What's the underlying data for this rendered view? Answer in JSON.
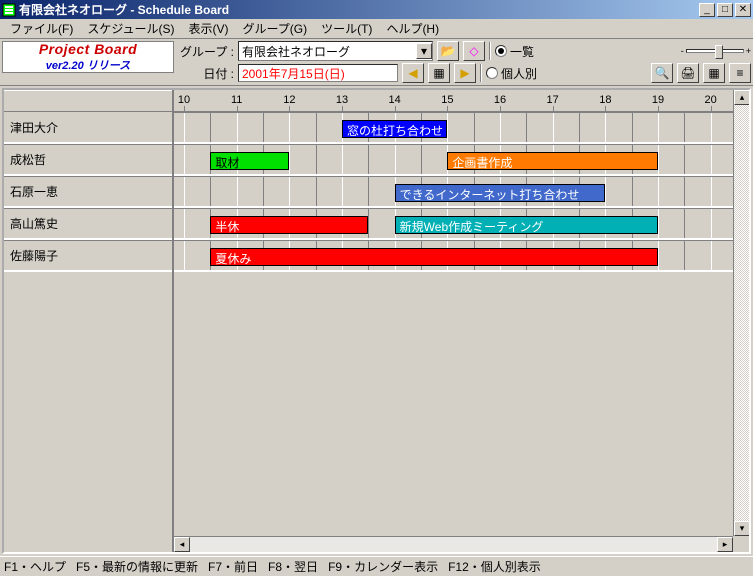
{
  "window": {
    "title": "有限会社ネオローグ - Schedule Board"
  },
  "menu": [
    "ファイル(F)",
    "スケジュール(S)",
    "表示(V)",
    "グループ(G)",
    "ツール(T)",
    "ヘルプ(H)"
  ],
  "logo": {
    "line1": "Project Board",
    "line2": "ver2.20 リリース"
  },
  "toolbar": {
    "group_label": "グループ :",
    "group_value": "有限会社ネオローグ",
    "date_label": "日付 :",
    "date_value": "2001年7月15日(日)",
    "view_list": "一覧",
    "view_personal": "個人別"
  },
  "timeline": {
    "start": 10,
    "end": 20
  },
  "rows": [
    {
      "name": "津田大介",
      "bars": [
        {
          "label": "窓の杜打ち合わせ",
          "from": 13.0,
          "to": 15.0,
          "bg": "#0000ff"
        }
      ]
    },
    {
      "name": "成松哲",
      "bars": [
        {
          "label": "取材",
          "from": 10.5,
          "to": 12.0,
          "bg": "#00e000",
          "fg": "#000"
        },
        {
          "label": "企画書作成",
          "from": 15.0,
          "to": 19.0,
          "bg": "#ff7a00"
        }
      ]
    },
    {
      "name": "石原一恵",
      "bars": [
        {
          "label": "できるインターネット打ち合わせ",
          "from": 14.0,
          "to": 18.0,
          "bg": "#4169cc"
        }
      ]
    },
    {
      "name": "高山篤史",
      "bars": [
        {
          "label": "半休",
          "from": 10.5,
          "to": 13.5,
          "bg": "#ff0000"
        },
        {
          "label": "新規Web作成ミーティング",
          "from": 14.0,
          "to": 19.0,
          "bg": "#00b0b4"
        }
      ]
    },
    {
      "name": "佐藤陽子",
      "bars": [
        {
          "label": "夏休み",
          "from": 10.5,
          "to": 19.0,
          "bg": "#ff0000"
        }
      ]
    }
  ],
  "status": [
    "F1・ヘルプ",
    "F5・最新の情報に更新",
    "F7・前日",
    "F8・翌日",
    "F9・カレンダー表示",
    "F12・個人別表示"
  ]
}
